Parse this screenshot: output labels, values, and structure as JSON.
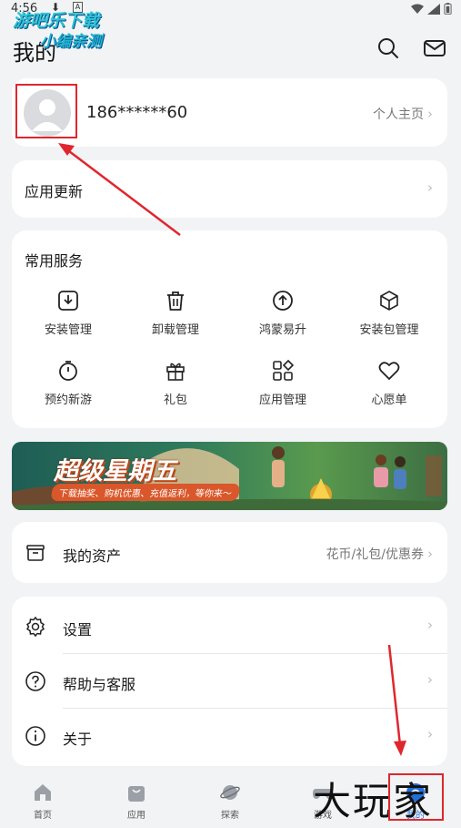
{
  "status": {
    "time": "4:56"
  },
  "watermark": {
    "line1": "游吧乐下载",
    "line2": "小编亲测"
  },
  "header": {
    "title": "我的",
    "search_icon": "search-icon",
    "mail_icon": "mail-icon"
  },
  "profile": {
    "phone": "186******60",
    "home_link": "个人主页"
  },
  "update": {
    "label": "应用更新"
  },
  "services": {
    "title": "常用服务",
    "items": [
      {
        "label": "安装管理",
        "icon": "install-icon"
      },
      {
        "label": "卸载管理",
        "icon": "trash-icon"
      },
      {
        "label": "鸿蒙易升",
        "icon": "upgrade-icon"
      },
      {
        "label": "安装包管理",
        "icon": "package-icon"
      },
      {
        "label": "预约新游",
        "icon": "stopwatch-icon"
      },
      {
        "label": "礼包",
        "icon": "gift-icon"
      },
      {
        "label": "应用管理",
        "icon": "apps-icon"
      },
      {
        "label": "心愿单",
        "icon": "heart-icon"
      }
    ]
  },
  "banner": {
    "title": "超级星期五",
    "subtitle": "下载抽奖、购机优惠、充值返利，等你来～"
  },
  "assets": {
    "label": "我的资产",
    "right": "花币/礼包/优惠券"
  },
  "settings_list": [
    {
      "label": "设置",
      "icon": "gear-icon"
    },
    {
      "label": "帮助与客服",
      "icon": "help-icon"
    },
    {
      "label": "关于",
      "icon": "info-icon"
    }
  ],
  "nav": [
    {
      "label": "首页",
      "icon": "home-icon"
    },
    {
      "label": "应用",
      "icon": "app-bag-icon"
    },
    {
      "label": "探索",
      "icon": "planet-icon"
    },
    {
      "label": "游戏",
      "icon": "gamepad-icon"
    },
    {
      "label": "我的",
      "icon": "profile-icon",
      "active": true
    }
  ],
  "corner_watermark": "大玩家",
  "colors": {
    "accent": "#1f6fd9",
    "annotation": "#e0262d",
    "background": "#f1f3f5"
  }
}
